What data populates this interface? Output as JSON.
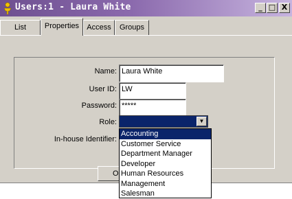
{
  "window": {
    "title": "Users:1 - Laura White",
    "controls": {
      "minimize": "_",
      "maximize": "□",
      "close": "X"
    }
  },
  "tabs": [
    {
      "label": "List"
    },
    {
      "label": "Properties",
      "active": true
    },
    {
      "label": "Access"
    },
    {
      "label": "Groups"
    }
  ],
  "form": {
    "name_label": "Name:",
    "name_value": "Laura White",
    "userid_label": "User ID:",
    "userid_value": "LW",
    "password_label": "Password:",
    "password_value": "*****",
    "role_label": "Role:",
    "role_value": "",
    "inhouse_label": "In-house Identifier:"
  },
  "role_options": [
    "Accounting",
    "Customer Service",
    "Department Manager",
    "Developer",
    "Human Resources",
    "Management",
    "Salesman"
  ],
  "selected_role_index": 0,
  "ok_button": "OK",
  "colors": {
    "title_gradient_start": "#6e4f90",
    "title_gradient_end": "#c7b4df",
    "selection": "#0a246a",
    "face": "#d4d0c8"
  }
}
